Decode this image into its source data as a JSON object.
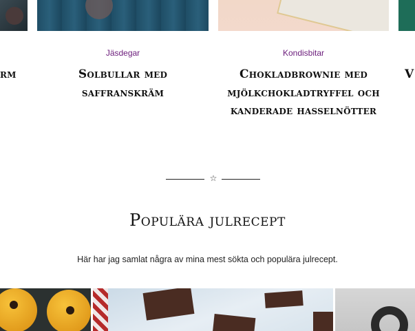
{
  "cards": [
    {
      "category": "",
      "title": "rm"
    },
    {
      "category": "Jäsdegar",
      "title": "Solbullar med saffranskräm"
    },
    {
      "category": "Kondisbitar",
      "title": "Chokladbrownie med mjölkchokladtryffel och kanderade hasselnötter"
    },
    {
      "category": "",
      "title": "V"
    }
  ],
  "divider": {
    "icon": "star-outline-icon",
    "glyph": "☆"
  },
  "section": {
    "title": "Populära julrecept",
    "subtitle": "Här har jag samlat några av mina mest sökta och populära julrecept."
  },
  "colors": {
    "accent": "#6a1b7a",
    "text": "#111111"
  }
}
